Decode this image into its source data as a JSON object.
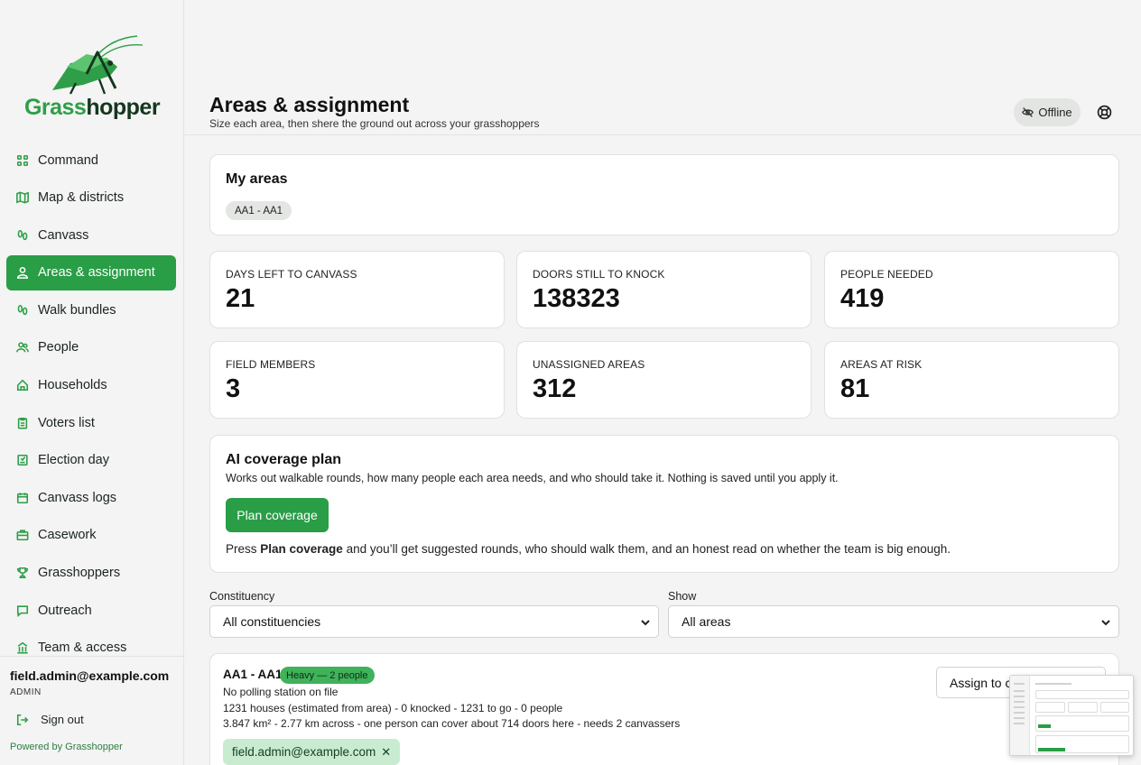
{
  "app": {
    "logo_text_part1": "Grass",
    "logo_text_part2": "hopper"
  },
  "sidebar": {
    "items": [
      {
        "label": "Command",
        "icon": "command-grid-icon"
      },
      {
        "label": "Map & districts",
        "icon": "map-icon"
      },
      {
        "label": "Canvass",
        "icon": "footsteps-icon"
      },
      {
        "label": "Areas & assignment",
        "icon": "user-pin-icon",
        "active": true
      },
      {
        "label": "Walk bundles",
        "icon": "footsteps-icon"
      },
      {
        "label": "People",
        "icon": "people-icon"
      },
      {
        "label": "Households",
        "icon": "home-icon"
      },
      {
        "label": "Voters list",
        "icon": "clipboard-icon"
      },
      {
        "label": "Election day",
        "icon": "ballot-box-icon"
      },
      {
        "label": "Canvass logs",
        "icon": "calendar-icon"
      },
      {
        "label": "Casework",
        "icon": "briefcase-icon"
      },
      {
        "label": "Grasshoppers",
        "icon": "trophy-icon"
      },
      {
        "label": "Outreach",
        "icon": "chat-icon"
      },
      {
        "label": "Team & access",
        "icon": "building-icon"
      }
    ],
    "footer": {
      "email": "field.admin@example.com",
      "role": "ADMIN",
      "signout_label": "Sign out",
      "powered_by": "Powered by Grasshopper"
    }
  },
  "header": {
    "title": "Areas & assignment",
    "subtitle": "Size each area, then shere the ground out across your grasshoppers",
    "offline_label": "Offline"
  },
  "my_areas": {
    "title": "My areas",
    "chip": "AA1 - AA1"
  },
  "stats": [
    {
      "label": "DAYS LEFT TO CANVASS",
      "value": "21"
    },
    {
      "label": "DOORS STILL TO KNOCK",
      "value": "138323"
    },
    {
      "label": "PEOPLE NEEDED",
      "value": "419"
    },
    {
      "label": "FIELD MEMBERS",
      "value": "3"
    },
    {
      "label": "UNASSIGNED AREAS",
      "value": "312"
    },
    {
      "label": "AREAS AT RISK",
      "value": "81"
    }
  ],
  "ai_plan": {
    "title": "AI coverage plan",
    "description": "Works out walkable rounds, how many people each area needs, and who should take it. Nothing is saved until you apply it.",
    "button_label": "Plan coverage",
    "note_prefix": "Press ",
    "note_bold": "Plan coverage",
    "note_suffix": " and you’ll get suggested rounds, who should walk them, and an honest read on whether the team is big enough."
  },
  "filters": {
    "constituency_label": "Constituency",
    "constituency_value": "All constituencies",
    "show_label": "Show",
    "show_value": "All areas"
  },
  "area_card": {
    "name": "AA1 - AA1",
    "badge": "Heavy — 2 people",
    "line1": "No polling station on file",
    "line2": "1231 houses (estimated from area) - 0 knocked - 1231 to go - 0 people",
    "line3": "3.847 km² - 2.77 km across - one person can cover about 714 doors here - needs 2 canvassers",
    "assignee": "field.admin@example.com",
    "assign_button": "Assign to c"
  },
  "colors": {
    "accent": "#2a9d47",
    "brand_dark": "#16361f",
    "badge": "#3fb25a",
    "chip_green": "#c9ecd1"
  }
}
